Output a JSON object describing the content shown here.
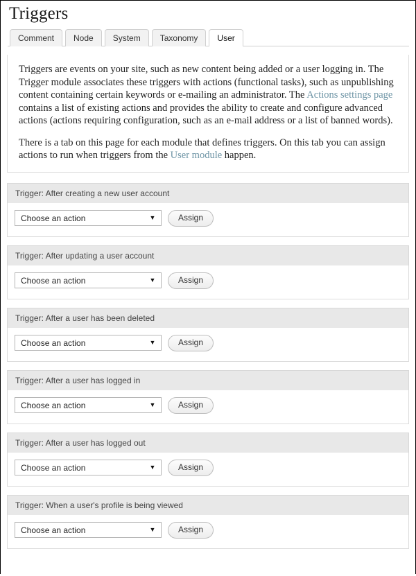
{
  "page": {
    "title": "Triggers"
  },
  "tabs": [
    {
      "label": "Comment",
      "active": false
    },
    {
      "label": "Node",
      "active": false
    },
    {
      "label": "System",
      "active": false
    },
    {
      "label": "Taxonomy",
      "active": false
    },
    {
      "label": "User",
      "active": true
    }
  ],
  "intro": {
    "paragraph1_part1": "Triggers are events on your site, such as new content being added or a user logging in. The Trigger module associates these triggers with actions (functional tasks), such as unpublishing content containing certain keywords or e-mailing an administrator. The ",
    "paragraph1_link": "Actions settings page",
    "paragraph1_part2": " contains a list of existing actions and provides the ability to create and configure advanced actions (actions requiring configuration, such as an e-mail address or a list of banned words).",
    "paragraph2_part1": "There is a tab on this page for each module that defines triggers. On this tab you can assign actions to run when triggers from the ",
    "paragraph2_link": "User module",
    "paragraph2_part2": " happen."
  },
  "controls": {
    "select_value": "Choose an action",
    "select_caret": "▼",
    "assign_label": "Assign"
  },
  "triggers": [
    {
      "header": "Trigger: After creating a new user account"
    },
    {
      "header": "Trigger: After updating a user account"
    },
    {
      "header": "Trigger: After a user has been deleted"
    },
    {
      "header": "Trigger: After a user has logged in"
    },
    {
      "header": "Trigger: After a user has logged out"
    },
    {
      "header": "Trigger: When a user's profile is being viewed"
    }
  ],
  "colors": {
    "link": "#6d94a5",
    "header_bar": "#e8e8e8",
    "border": "#dcdcdc"
  }
}
